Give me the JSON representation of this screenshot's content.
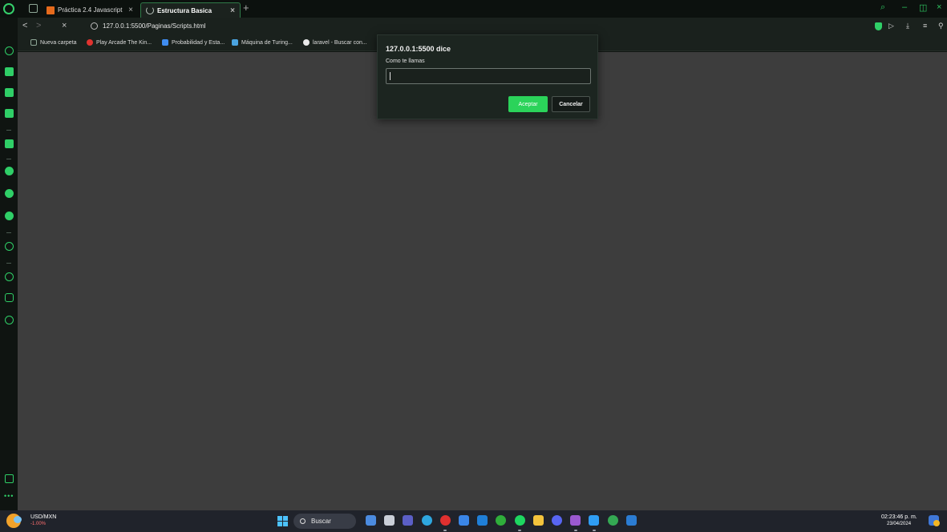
{
  "tabs": [
    {
      "label": "Práctica 2.4 Javascript",
      "close": "×",
      "favicon": "orange-slides-icon"
    },
    {
      "label": "Estructura Basica",
      "close": "×",
      "favicon": "loading-spinner-icon",
      "active": true
    }
  ],
  "new_tab": "+",
  "window_controls": {
    "search": "⌕",
    "minimize": "–",
    "restore": "◫",
    "close": "×"
  },
  "nav": {
    "back": "<",
    "forward": ">",
    "stop": "×"
  },
  "address": {
    "url": "127.0.0.1:5500/Paginas/Scripts.html"
  },
  "toolbar_icons": {
    "send": "▷",
    "download": "⤓",
    "menu": "≡",
    "profile": "⚲"
  },
  "bookmarks": [
    {
      "label": "Nueva carpeta",
      "icon": "folder-icon",
      "color": "#8fa897"
    },
    {
      "label": "Play Arcade The Kin...",
      "icon": "arcade-icon",
      "color": "#e0332f"
    },
    {
      "label": "Probabilidad y Esta...",
      "icon": "bookmark-icon",
      "color": "#3f8cf0"
    },
    {
      "label": "Máquina de Turing...",
      "icon": "turing-icon",
      "color": "#4aa3df"
    },
    {
      "label": "laravel - Buscar con...",
      "icon": "google-icon",
      "color": "#e8e8e8"
    }
  ],
  "dialog": {
    "title": "127.0.0.1:5500 dice",
    "message": "Como te llamas",
    "input_value": "",
    "ok_label": "Aceptar",
    "cancel_label": "Cancelar"
  },
  "taskbar": {
    "currency_pair": "USD/MXN",
    "currency_change": "-1.00%",
    "search_label": "Buscar",
    "time": "02:23:46 p. m.",
    "date": "23/04/2024",
    "apps": [
      {
        "name": "widgets",
        "color": "#4b8be0"
      },
      {
        "name": "task-view",
        "color": "#c9ced8"
      },
      {
        "name": "teams",
        "color": "#5b5fc7"
      },
      {
        "name": "edge",
        "color": "#2ea7e0"
      },
      {
        "name": "opera",
        "color": "#e0302f"
      },
      {
        "name": "store",
        "color": "#3a86e8"
      },
      {
        "name": "mail",
        "color": "#1f7fd8"
      },
      {
        "name": "xbox",
        "color": "#2fae3b"
      },
      {
        "name": "spotify",
        "color": "#1ed760"
      },
      {
        "name": "explorer",
        "color": "#f3c33c"
      },
      {
        "name": "discord",
        "color": "#5865f2"
      },
      {
        "name": "visual-studio",
        "color": "#9b59d0"
      },
      {
        "name": "vscode",
        "color": "#2f9df4"
      },
      {
        "name": "chrome",
        "color": "#34a853"
      },
      {
        "name": "word",
        "color": "#2b7cd3"
      }
    ]
  },
  "accent": "#2fcf67"
}
